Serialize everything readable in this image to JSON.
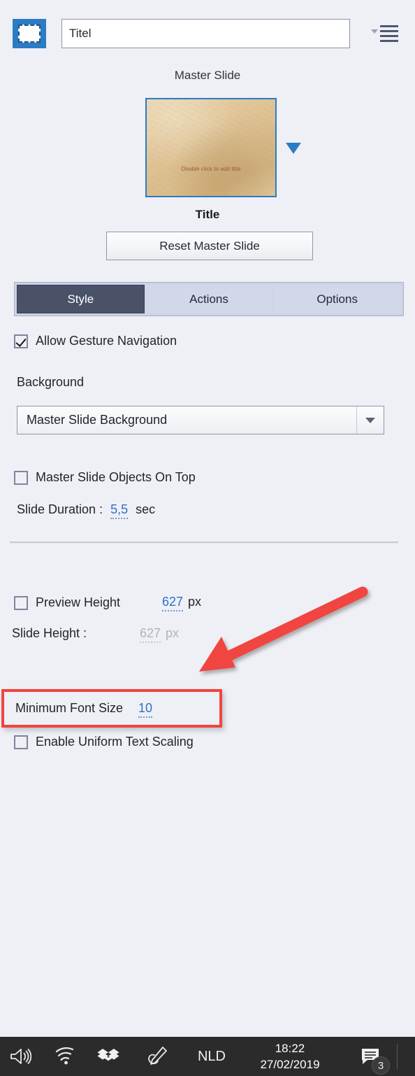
{
  "top_bar": {
    "slide_icon": "slide-placeholder-icon",
    "title_value": "Titel",
    "title_placeholder": "Titel",
    "menu_icon": "hamburger-menu-icon"
  },
  "master_slide": {
    "section_label": "Master Slide",
    "thumbnail_text": "Double click to add title",
    "thumbnail_name": "parchment-slide-thumbnail",
    "dropdown_arrow": "chevron-down-icon",
    "title": "Title",
    "reset_button": "Reset Master Slide"
  },
  "tabs": [
    {
      "label": "Style",
      "active": true
    },
    {
      "label": "Actions",
      "active": false
    },
    {
      "label": "Options",
      "active": false
    }
  ],
  "style_panel": {
    "allow_gesture_navigation": {
      "label": "Allow Gesture Navigation",
      "checked": true
    },
    "background_label": "Background",
    "background_select": {
      "value": "Master Slide Background",
      "arrow": "chevron-down-icon"
    },
    "master_slide_objects_on_top": {
      "label": "Master Slide Objects On Top",
      "checked": false
    },
    "slide_duration": {
      "label": "Slide Duration :",
      "value": "5,5",
      "unit": "sec"
    },
    "preview_height": {
      "label": "Preview Height",
      "checked": false,
      "value": "627",
      "unit": "px"
    },
    "slide_height": {
      "label": "Slide Height :",
      "value": "627",
      "unit": "px",
      "disabled": true
    },
    "minimum_font_size": {
      "label": "Minimum Font Size",
      "value": "10"
    },
    "enable_uniform_text_scaling": {
      "label": "Enable Uniform Text Scaling",
      "checked": false
    }
  },
  "annotations": {
    "highlight_box_target": "minimum-font-size-row",
    "arrow_color": "#f0453f",
    "highlight_color": "#f0453f"
  },
  "taskbar": {
    "volume_icon": "speaker-icon",
    "wifi_icon": "wifi-icon",
    "dropbox_icon": "dropbox-icon",
    "pen_icon": "stylus-pen-icon",
    "language": "NLD",
    "time": "18:22",
    "date": "27/02/2019",
    "notification_icon": "notification-message-icon",
    "notification_count": "3"
  }
}
